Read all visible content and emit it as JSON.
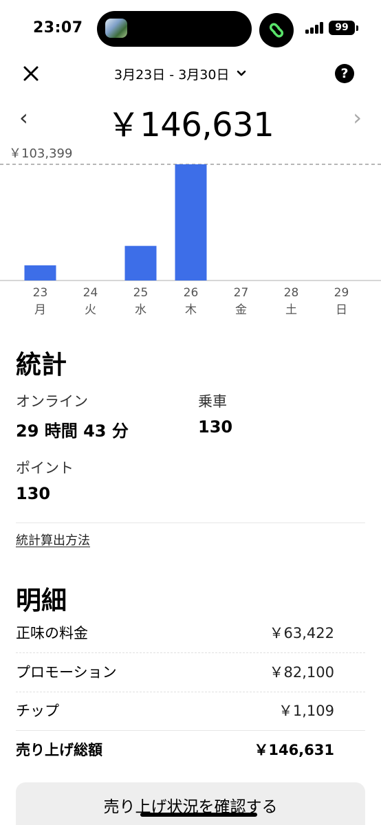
{
  "status_bar": {
    "time": "23:07",
    "battery": "99",
    "icons": [
      "island-thumbnail-icon",
      "linked-rings-app-icon",
      "cellular-signal-icon",
      "battery-icon"
    ]
  },
  "header": {
    "close_icon": "close-icon",
    "date_range": "3月23日 - 3月30日",
    "dropdown_icon": "chevron-down-icon",
    "help_icon": "help-icon",
    "help_glyph": "?"
  },
  "summary": {
    "prev_glyph": "‹",
    "next_glyph": "›",
    "total": "￥146,631"
  },
  "chart_data": {
    "type": "bar",
    "categories": [
      "23",
      "24",
      "25",
      "26",
      "27",
      "28",
      "29"
    ],
    "weekdays": [
      "月",
      "火",
      "水",
      "木",
      "金",
      "土",
      "日"
    ],
    "values": [
      13500,
      0,
      30800,
      103399,
      0,
      0,
      0
    ],
    "max_label": "￥103,399",
    "max_value": 103399,
    "bar_color": "#3d6ee8",
    "grid": false
  },
  "stats": {
    "title": "統計",
    "online_label": "オンライン",
    "online_value": "29 時間 43 分",
    "rides_label": "乗車",
    "rides_value": "130",
    "points_label": "ポイント",
    "points_value": "130",
    "method_link": "統計算出方法"
  },
  "breakdown": {
    "title": "明細",
    "rows": [
      {
        "label": "正味の料金",
        "amount": "￥63,422"
      },
      {
        "label": "プロモーション",
        "amount": "￥82,100"
      },
      {
        "label": "チップ",
        "amount": "￥1,109"
      }
    ],
    "total_label": "売り上げ総額",
    "total_amount": "￥146,631"
  },
  "footer": {
    "button_label": "売り上げ状況を確認する"
  }
}
